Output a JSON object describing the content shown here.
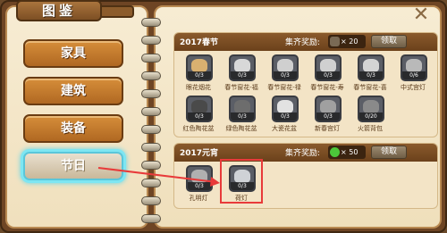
{
  "title": "图鉴",
  "close_glyph": "✕",
  "categories": [
    {
      "label": "家具"
    },
    {
      "label": "建筑"
    },
    {
      "label": "装备"
    },
    {
      "label": "节日"
    }
  ],
  "section1": {
    "title": "2017春节",
    "reward_label": "集齐奖励:",
    "reward_count": "× 20",
    "claim_label": "领取",
    "items": [
      {
        "name": "眼花烟花",
        "count": "0/3",
        "color": "#d9b070"
      },
      {
        "name": "春节窗花-福",
        "count": "0/3",
        "color": "#d8d8d8"
      },
      {
        "name": "春节窗花-禄",
        "count": "0/3",
        "color": "#cfcfcf"
      },
      {
        "name": "春节窗花-寿",
        "count": "0/3",
        "color": "#d0d0d0"
      },
      {
        "name": "春节窗花-喜",
        "count": "0/3",
        "color": "#d4d4d4"
      },
      {
        "name": "中式宫灯",
        "count": "0/6",
        "color": "#b9b9b9"
      },
      {
        "name": "红色陶花盆",
        "count": "0/3",
        "color": "#4a4a4a"
      },
      {
        "name": "绿色陶花盆",
        "count": "0/3",
        "color": "#6d6d6d"
      },
      {
        "name": "大瓷花盆",
        "count": "0/3",
        "color": "#e2e2e2"
      },
      {
        "name": "新春宫灯",
        "count": "0/3",
        "color": "#a0a0a0"
      },
      {
        "name": "火箭背包",
        "count": "0/20",
        "color": "#8a8a8a"
      }
    ]
  },
  "section2": {
    "title": "2017元宵",
    "reward_label": "集齐奖励:",
    "reward_count": "× 50",
    "claim_label": "领取",
    "items": [
      {
        "name": "孔明灯",
        "count": "0/3",
        "color": "#b0b0b0"
      },
      {
        "name": "荷灯",
        "count": "0/3",
        "color": "#cfd2d6"
      }
    ]
  },
  "colors": {
    "accent_red": "#e83a3a",
    "active_glow": "#7ee6f2"
  }
}
